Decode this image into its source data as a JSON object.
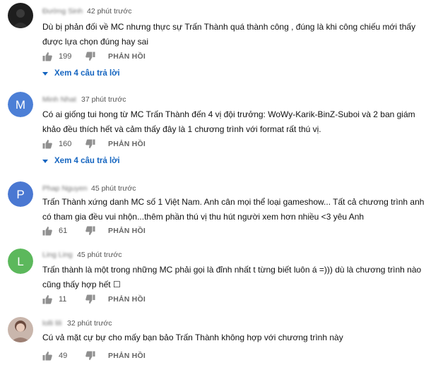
{
  "reply_label": "PHẢN HỒI",
  "accent_color": "#1565c0",
  "comments": [
    {
      "author": "Đường Sinh",
      "time": "42 phút trước",
      "text": "Dù bị phản đối về MC nhưng thực sự Trấn Thành quá thành công , đúng là khi công chiếu mới thấy được lựa chọn đúng hay sai",
      "likes": "199",
      "view_replies": "Xem 4 câu trả lời"
    },
    {
      "author": "Minh Nhat",
      "time": "37 phút trước",
      "text": "Có ai giống tui hong từ MC Trấn Thành đến 4 vị đội trưởng: WoWy-Karik-BinZ-Suboi và 2 ban giám khảo đều thích hết và cảm thấy đây là 1 chương trình với format rất thú vị.",
      "likes": "160",
      "view_replies": "Xem 4 câu trả lời"
    },
    {
      "author": "Phap Nguyen",
      "time": "45 phút trước",
      "text": "Trấn Thành xứng danh MC số 1 Việt Nam. Anh cân mọi thể loại gameshow... Tất cả chương trình anh có tham gia đều vui nhộn...thêm phần thú vị thu hút người xem hơn nhiều <3 yêu Anh",
      "likes": "61"
    },
    {
      "author": "Ling Ling",
      "time": "45 phút trước",
      "text": "Trấn thành là một trong những MC phải gọi là đỉnh nhất t từng biết luôn á =))) dù là chương trình nào cũng thấy hợp hết ☐",
      "likes": "11"
    },
    {
      "author": "lolli lili",
      "time": "32 phút trước",
      "text": "Cú vả mặt cự bự cho mấy bạn bảo Trấn Thành không hợp với chương trình này",
      "likes": "49"
    }
  ]
}
